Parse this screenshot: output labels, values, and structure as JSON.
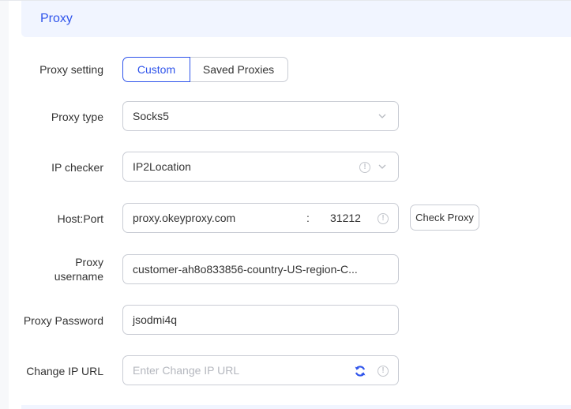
{
  "section": {
    "title": "Proxy"
  },
  "proxy_setting": {
    "label": "Proxy setting",
    "options": [
      {
        "label": "Custom",
        "selected": true
      },
      {
        "label": "Saved Proxies",
        "selected": false
      }
    ]
  },
  "proxy_type": {
    "label": "Proxy type",
    "value": "Socks5",
    "icon": "chevron-down-icon"
  },
  "ip_checker": {
    "label": "IP checker",
    "value": "IP2Location",
    "icons": [
      "info-icon",
      "chevron-down-icon"
    ]
  },
  "host_port": {
    "label": "Host:Port",
    "host": "proxy.okeyproxy.com",
    "separator": ":",
    "port": "31212",
    "icon": "info-icon",
    "check_button": "Check Proxy"
  },
  "proxy_username": {
    "label_line1": "Proxy",
    "label_line2": "username",
    "value": "customer-ah8o833856-country-US-region-C..."
  },
  "proxy_password": {
    "label": "Proxy Password",
    "value": "jsodmi4q"
  },
  "change_ip_url": {
    "label": "Change IP URL",
    "placeholder": "Enter Change IP URL",
    "icons": [
      "refresh-icon",
      "info-icon"
    ]
  },
  "colors": {
    "accent": "#2f54eb",
    "header_bg": "#f1f5ff",
    "border": "#c9ccd4"
  },
  "glyphs": {
    "chevron": "⌄",
    "info": "!"
  }
}
